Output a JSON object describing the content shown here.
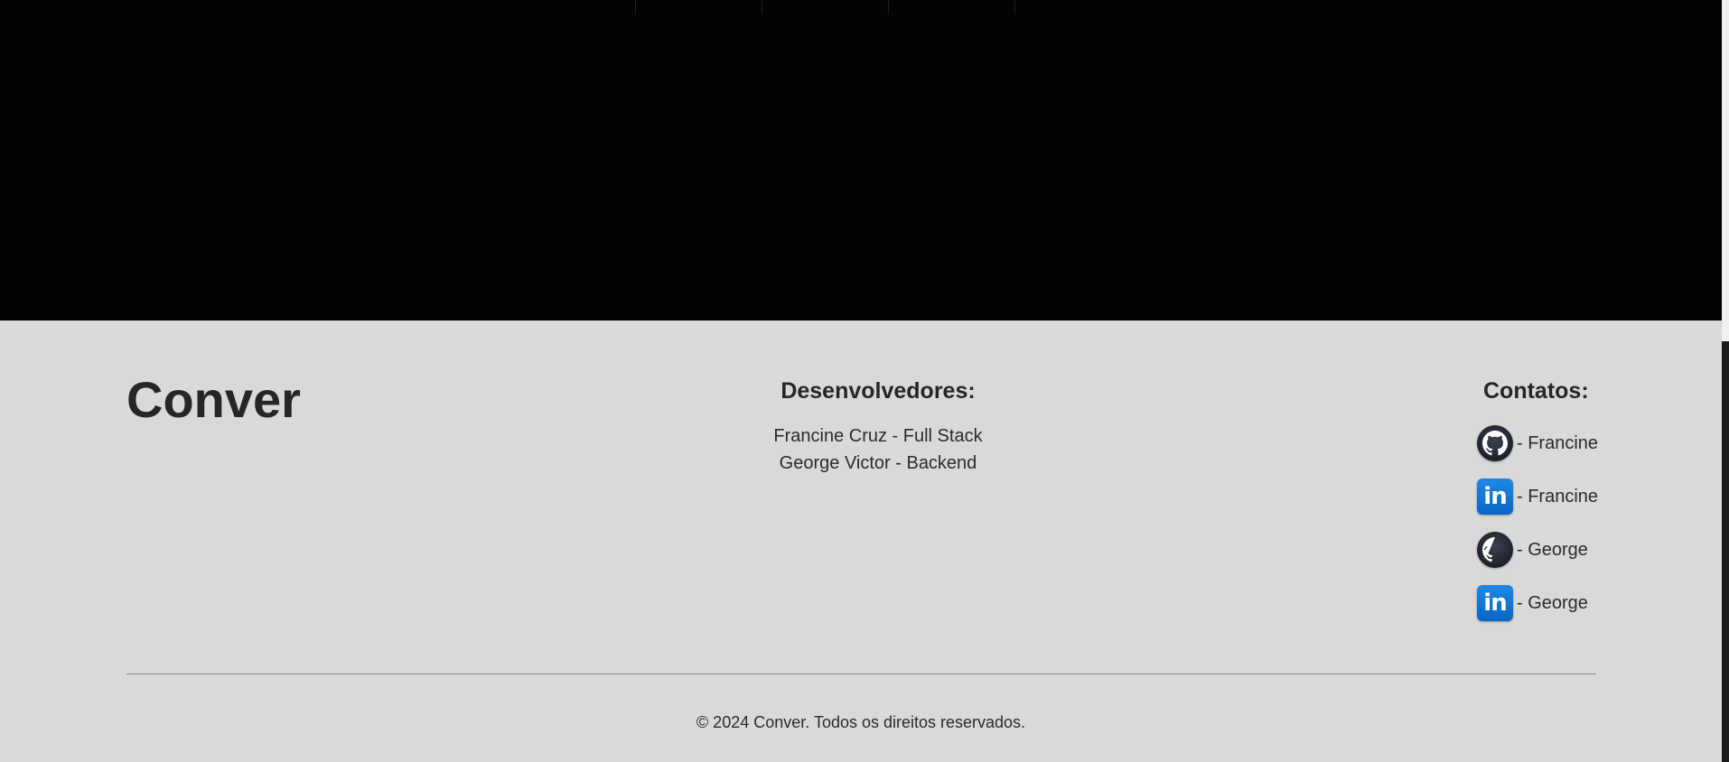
{
  "footer": {
    "brand": "Conver",
    "developers": {
      "heading": "Desenvolvedores:",
      "items": [
        "Francine Cruz - Full Stack",
        "George Victor - Backend"
      ]
    },
    "contacts": {
      "heading": "Contatos:",
      "items": [
        {
          "icon": "github-icon",
          "label": "- Francine"
        },
        {
          "icon": "linkedin-icon",
          "label": "- Francine"
        },
        {
          "icon": "github-icon",
          "label": "- George"
        },
        {
          "icon": "linkedin-icon",
          "label": "- George"
        }
      ]
    },
    "copyright": "© 2024 Conver. Todos os direitos reservados."
  },
  "colors": {
    "hero_background": "#030303",
    "footer_background": "#d9d9d9",
    "text": "#262626",
    "linkedin": "#0a66c2",
    "github": "#1d2129"
  }
}
